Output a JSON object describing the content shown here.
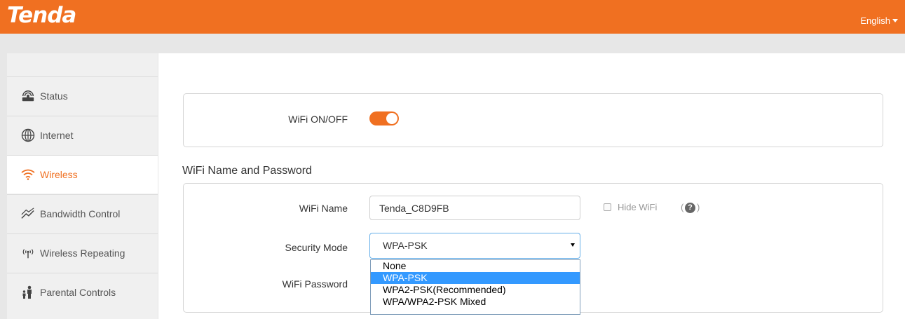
{
  "header": {
    "logo": "Tenda",
    "language": "English"
  },
  "sidebar": {
    "items": [
      {
        "label": "Status",
        "icon": "router-icon",
        "active": false
      },
      {
        "label": "Internet",
        "icon": "globe-icon",
        "active": false
      },
      {
        "label": "Wireless",
        "icon": "wifi-icon",
        "active": true
      },
      {
        "label": "Bandwidth Control",
        "icon": "bandwidth-icon",
        "active": false
      },
      {
        "label": "Wireless Repeating",
        "icon": "antenna-icon",
        "active": false
      },
      {
        "label": "Parental Controls",
        "icon": "family-icon",
        "active": false
      }
    ]
  },
  "wifi_switch": {
    "label": "WiFi ON/OFF",
    "enabled": true
  },
  "name_password": {
    "title": "WiFi Name and Password",
    "wifi_name_label": "WiFi Name",
    "wifi_name_value": "Tenda_C8D9FB",
    "hide_wifi_label": "Hide WiFi",
    "hide_wifi_checked": false,
    "help_symbol": "?",
    "security_mode_label": "Security Mode",
    "security_mode_value": "WPA-PSK",
    "security_options": [
      "None",
      "WPA-PSK",
      "WPA2-PSK(Recommended)",
      "WPA/WPA2-PSK Mixed"
    ],
    "wifi_password_label": "WiFi Password"
  },
  "colors": {
    "brand": "#f07021",
    "selected_option": "#3399ff"
  }
}
